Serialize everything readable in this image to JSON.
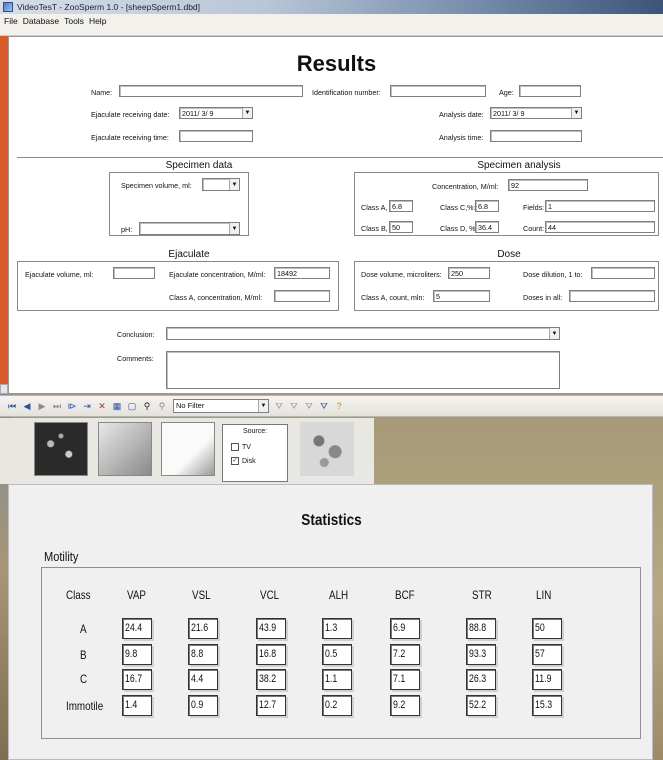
{
  "window": {
    "title": "VideoTesT - ZooSperm 1.0 - [sheepSperm1.dbd]"
  },
  "menu": [
    "File",
    "Database",
    "Tools",
    "Help"
  ],
  "results": {
    "heading": "Results",
    "name_label": "Name:",
    "name_value": "",
    "id_label": "Identification number:",
    "id_value": "",
    "age_label": "Age:",
    "age_value": "",
    "ejac_date_label": "Ejaculate receiving date:",
    "ejac_date_value": "2011/ 3/ 9",
    "analysis_date_label": "Analysis date:",
    "analysis_date_value": "2011/ 3/ 9",
    "ejac_time_label": "Ejaculate receiving time:",
    "ejac_time_value": "",
    "analysis_time_label": "Analysis time:",
    "analysis_time_value": "",
    "specimen_data": {
      "title": "Specimen data",
      "volume_label": "Specimen volume, ml:",
      "volume_value": "",
      "ph_label": "pH:",
      "ph_value": ""
    },
    "specimen_analysis": {
      "title": "Specimen analysis",
      "conc_label": "Concentration, M/ml:",
      "conc_value": "92",
      "class_a_label": "Class A, %:",
      "class_a_value": "6.8",
      "class_c_label": "Class C,%:",
      "class_c_value": "6.8",
      "fields_label": "Fields:",
      "fields_value": "1",
      "class_b_label": "Class B, %:",
      "class_b_value": "50",
      "class_d_label": "Class D, %:",
      "class_d_value": "36.4",
      "count_label": "Count:",
      "count_value": "44"
    },
    "ejaculate": {
      "title": "Ejaculate",
      "volume_label": "Ejaculate volume, ml:",
      "volume_value": "",
      "conc_label": "Ejaculate concentration, M/ml:",
      "conc_value": "18492",
      "class_a_label": "Class A, concentration, M/ml:",
      "class_a_value": ""
    },
    "dose": {
      "title": "Dose",
      "volume_label": "Dose volume, microliters:",
      "volume_value": "250",
      "dilution_label": "Dose dilution, 1 to:",
      "dilution_value": "",
      "class_a_count_label": "Class A, count, mln:",
      "class_a_count_value": "5",
      "doses_label": "Doses in all:",
      "doses_value": ""
    },
    "conclusion_label": "Conclusion:",
    "conclusion_value": "",
    "comments_label": "Comments:",
    "comments_value": ""
  },
  "toolbar": {
    "filter_value": "No Filter"
  },
  "source": {
    "title": "Source:",
    "tv_label": "TV",
    "disk_label": "Disk"
  },
  "statistics": {
    "title": "Statistics",
    "section": "Motility",
    "columns": [
      "Class",
      "VAP",
      "VSL",
      "VCL",
      "ALH",
      "BCF",
      "STR",
      "LIN"
    ],
    "rows": [
      {
        "label": "A",
        "values": [
          "24.4",
          "21.6",
          "43.9",
          "1.3",
          "6.9",
          "88.8",
          "50"
        ]
      },
      {
        "label": "B",
        "values": [
          "9.8",
          "8.8",
          "16.8",
          "0.5",
          "7.2",
          "93.3",
          "57"
        ]
      },
      {
        "label": "C",
        "values": [
          "16.7",
          "4.4",
          "38.2",
          "1.1",
          "7.1",
          "26.3",
          "11.9"
        ]
      },
      {
        "label": "Immotile",
        "values": [
          "1.4",
          "0.9",
          "12.7",
          "0.2",
          "9.2",
          "52.2",
          "15.3"
        ]
      }
    ]
  }
}
